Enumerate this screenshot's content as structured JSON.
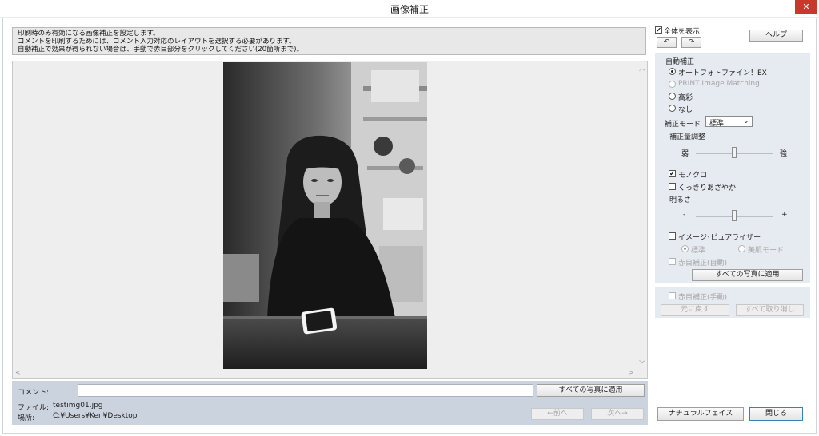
{
  "window": {
    "title": "画像補正",
    "close_glyph": "✕"
  },
  "info": {
    "lines": [
      "印刷時のみ有効になる画像補正を設定します。",
      "コメントを印刷するためには、コメント入力対応のレイアウトを選択する必要があります。",
      "自動補正で効果が得られない場合は、手動で赤目部分をクリックしてください(20箇所まで)。"
    ]
  },
  "bottom": {
    "comment_label": "コメント:",
    "comment_value": "",
    "apply_all_label": "すべての写真に適用",
    "file_label": "ファイル:",
    "file_value": "testimg01.jpg",
    "location_label": "場所:",
    "location_value": "C:¥Users¥Ken¥Desktop",
    "prev_label": "←前へ",
    "next_label": "次へ→"
  },
  "right": {
    "show_all_label": "全体を表示",
    "show_all_checked": true,
    "help_label": "ヘルプ",
    "auto_section_label": "自動補正",
    "radio_options": [
      {
        "label": "オートフォトファイン！EX",
        "selected": true,
        "enabled": true
      },
      {
        "label": "PRINT Image Matching",
        "selected": false,
        "enabled": false
      },
      {
        "label": "高彩",
        "selected": false,
        "enabled": true
      },
      {
        "label": "なし",
        "selected": false,
        "enabled": true
      }
    ],
    "mode_label": "補正モード",
    "mode_value": "標準",
    "amount_label": "補正量調整",
    "amount_low": "弱",
    "amount_high": "強",
    "amount_level": 0.5,
    "mono_label": "モノクロ",
    "mono_checked": true,
    "vivid_label": "くっきりあざやか",
    "vivid_checked": false,
    "brightness_label": "明るさ",
    "bright_minus": "-",
    "bright_plus": "+",
    "bright_level": 0.5,
    "purifier_label": "イメージ･ピュアライザー",
    "purifier_checked": false,
    "purifier_std": "標準",
    "purifier_beauty": "美肌モード",
    "redeye_auto_label": "赤目補正(自動)",
    "apply_all_label": "すべての写真に適用",
    "redeye_manual_label": "赤目補正(手動)",
    "undo_label": "元に戻す",
    "cancel_all_label": "すべて取り消し",
    "natural_face_label": "ナチュラルフェイス",
    "close_label": "閉じる"
  }
}
